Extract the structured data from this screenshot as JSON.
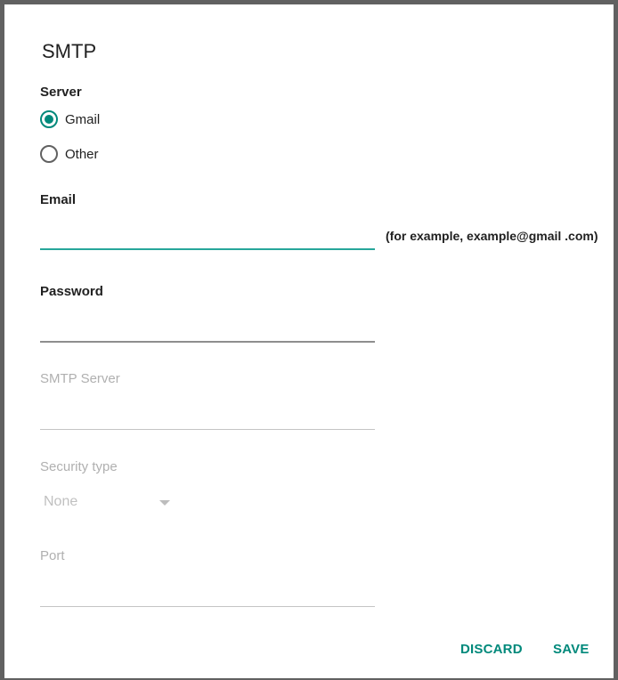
{
  "dialog": {
    "title": "SMTP"
  },
  "server": {
    "label": "Server",
    "options": [
      {
        "label": "Gmail",
        "checked": true
      },
      {
        "label": "Other",
        "checked": false
      }
    ]
  },
  "email": {
    "label": "Email",
    "value": "",
    "helper_text": "(for example, example@gmail .com)"
  },
  "password": {
    "label": "Password",
    "value": ""
  },
  "smtp_server": {
    "label": "SMTP Server",
    "value": ""
  },
  "security_type": {
    "label": "Security type",
    "selected": "None"
  },
  "port": {
    "label": "Port",
    "value": ""
  },
  "actions": {
    "discard_label": "DISCARD",
    "save_label": "SAVE"
  },
  "colors": {
    "accent": "#00897b",
    "focused_underline": "#26a69a",
    "disabled_text": "#b0b0b0"
  }
}
